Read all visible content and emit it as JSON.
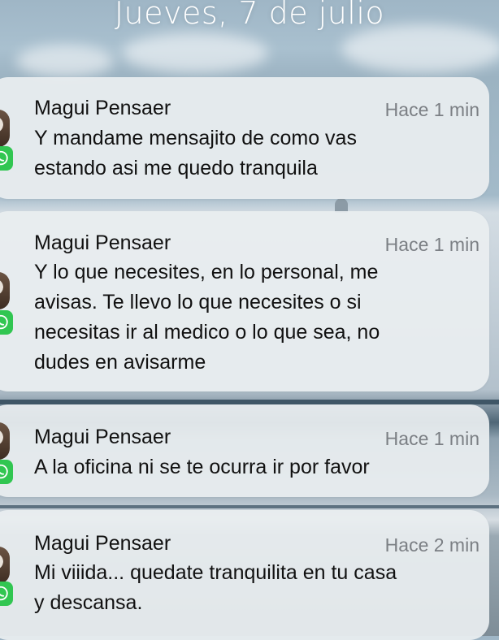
{
  "lockscreen": {
    "date": "Jueves, 7 de julio"
  },
  "notifications": [
    {
      "app_icon": "whatsapp-icon",
      "sender": "Magui Pensaer",
      "time": "Hace 1 min",
      "message": "Y mandame mensajito de como vas\nestando asi me quedo tranquila"
    },
    {
      "app_icon": "whatsapp-icon",
      "sender": "Magui Pensaer",
      "time": "Hace 1 min",
      "message": "Y lo que necesites, en lo personal, me\navisas. Te llevo lo que necesites o si\nnecesitas ir al medico o lo que sea, no\ndudes en avisarme"
    },
    {
      "app_icon": "whatsapp-icon",
      "sender": "Magui Pensaer",
      "time": "Hace 1 min",
      "message": "A la oficina ni se te ocurra ir por favor"
    },
    {
      "app_icon": "whatsapp-icon",
      "sender": "Magui Pensaer",
      "time": "Hace 2 min",
      "message": "Mi viiida... quedate tranquilita en tu casa\ny descansa."
    }
  ],
  "colors": {
    "whatsapp_green": "#31c651",
    "time_gray": "#7b7f84"
  }
}
